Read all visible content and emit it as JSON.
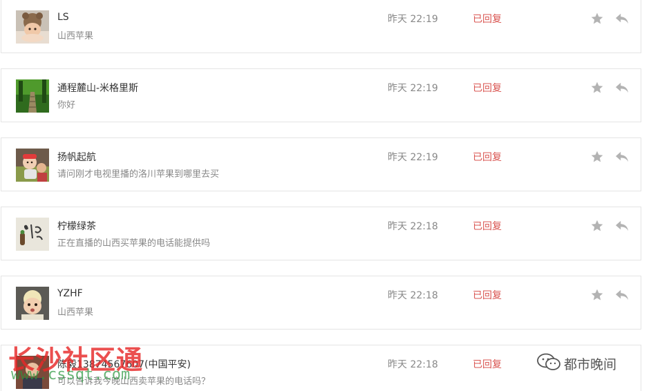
{
  "messages": [
    {
      "nickname": "LS",
      "message": "山西苹果",
      "time": "昨天 22:19",
      "status": "已回复",
      "avatar": "baby-in-knit-hat-avatar"
    },
    {
      "nickname": "通程麓山-米格里斯",
      "message": "你好",
      "time": "昨天 22:19",
      "status": "已回复",
      "avatar": "forest-path-avatar"
    },
    {
      "nickname": "扬帆起航",
      "message": "请问刚才电视里播的洛川苹果到哪里去买",
      "time": "昨天 22:19",
      "status": "已回复",
      "avatar": "child-photo-avatar"
    },
    {
      "nickname": "柠檬绿茶",
      "message": "正在直播的山西买苹果的电话能提供吗",
      "time": "昨天 22:18",
      "status": "已回复",
      "avatar": "calligraphy-avatar"
    },
    {
      "nickname": "YZHF",
      "message": "山西苹果",
      "time": "昨天 22:18",
      "status": "已回复",
      "avatar": "baby-face-avatar"
    },
    {
      "nickname": "陈毅13874567607(中国平安)",
      "message": "可以告诉我今晚山西卖苹果的电话吗？",
      "time": "昨天 22:18",
      "status": "已回复",
      "avatar": "person-avatar"
    }
  ],
  "icons": {
    "star": "star-icon",
    "reply": "reply-arrow-icon"
  },
  "colors": {
    "status_replied": "#d9534f",
    "icon_gray": "#b3b3b3",
    "border": "#e4e4e4"
  },
  "watermarks": {
    "left_title": "长沙社区通",
    "left_url": "www.cssqt.com",
    "right_brand": "都市晚间"
  }
}
